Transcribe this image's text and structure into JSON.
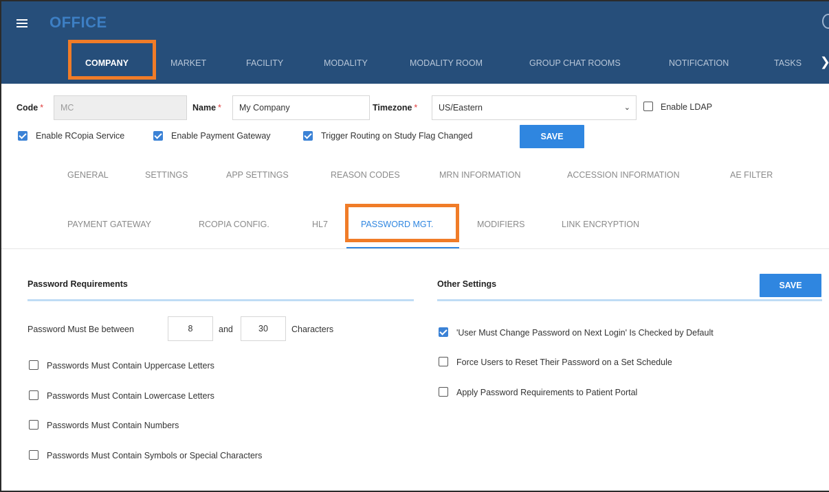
{
  "app": {
    "title": "OFFICE"
  },
  "nav": {
    "items": [
      "COMPANY",
      "MARKET",
      "FACILITY",
      "MODALITY",
      "MODALITY ROOM",
      "GROUP CHAT ROOMS",
      "NOTIFICATION",
      "TASKS"
    ],
    "active": "COMPANY"
  },
  "company_form": {
    "code_label": "Code",
    "code_value": "MC",
    "name_label": "Name",
    "name_value": "My Company",
    "timezone_label": "Timezone",
    "timezone_value": "US/Eastern",
    "required_mark": "*",
    "enable_ldap_label": "Enable LDAP",
    "enable_ldap_checked": false,
    "enable_rcopia_label": "Enable RCopia Service",
    "enable_rcopia_checked": true,
    "enable_payment_label": "Enable Payment Gateway",
    "enable_payment_checked": true,
    "trigger_routing_label": "Trigger Routing on Study Flag Changed",
    "trigger_routing_checked": true,
    "save_label": "SAVE"
  },
  "tabs": {
    "row1": [
      "GENERAL",
      "SETTINGS",
      "APP SETTINGS",
      "REASON CODES",
      "MRN INFORMATION",
      "ACCESSION INFORMATION",
      "AE FILTER"
    ],
    "row2": [
      "PAYMENT GATEWAY",
      "RCOPIA CONFIG.",
      "HL7",
      "PASSWORD MGT.",
      "MODIFIERS",
      "LINK ENCRYPTION"
    ],
    "active": "PASSWORD MGT."
  },
  "password_requirements": {
    "title": "Password Requirements",
    "length_prefix": "Password Must Be between",
    "min_length": "8",
    "and_label": "and",
    "max_length": "30",
    "length_suffix": "Characters",
    "options": [
      {
        "label": "Passwords Must Contain Uppercase Letters",
        "checked": false
      },
      {
        "label": "Passwords Must Contain Lowercase Letters",
        "checked": false
      },
      {
        "label": "Passwords Must Contain Numbers",
        "checked": false
      },
      {
        "label": "Passwords Must Contain Symbols or Special Characters",
        "checked": false
      }
    ]
  },
  "other_settings": {
    "title": "Other Settings",
    "save_label": "SAVE",
    "options": [
      {
        "label": "'User Must Change Password on Next Login' Is Checked by Default",
        "checked": true
      },
      {
        "label": "Force Users to Reset Their Password on a Set Schedule",
        "checked": false
      },
      {
        "label": "Apply Password Requirements to Patient Portal",
        "checked": false
      }
    ]
  },
  "colors": {
    "header_bg": "#264e7a",
    "accent_blue": "#2f86e0",
    "highlight_orange": "#f07c28",
    "required_red": "#e03b3b"
  },
  "icons": {
    "menu": "hamburger-menu-icon",
    "nav_more": "chevron-right-icon",
    "dropdown": "chevron-down-icon",
    "corner": "circle-icon"
  }
}
